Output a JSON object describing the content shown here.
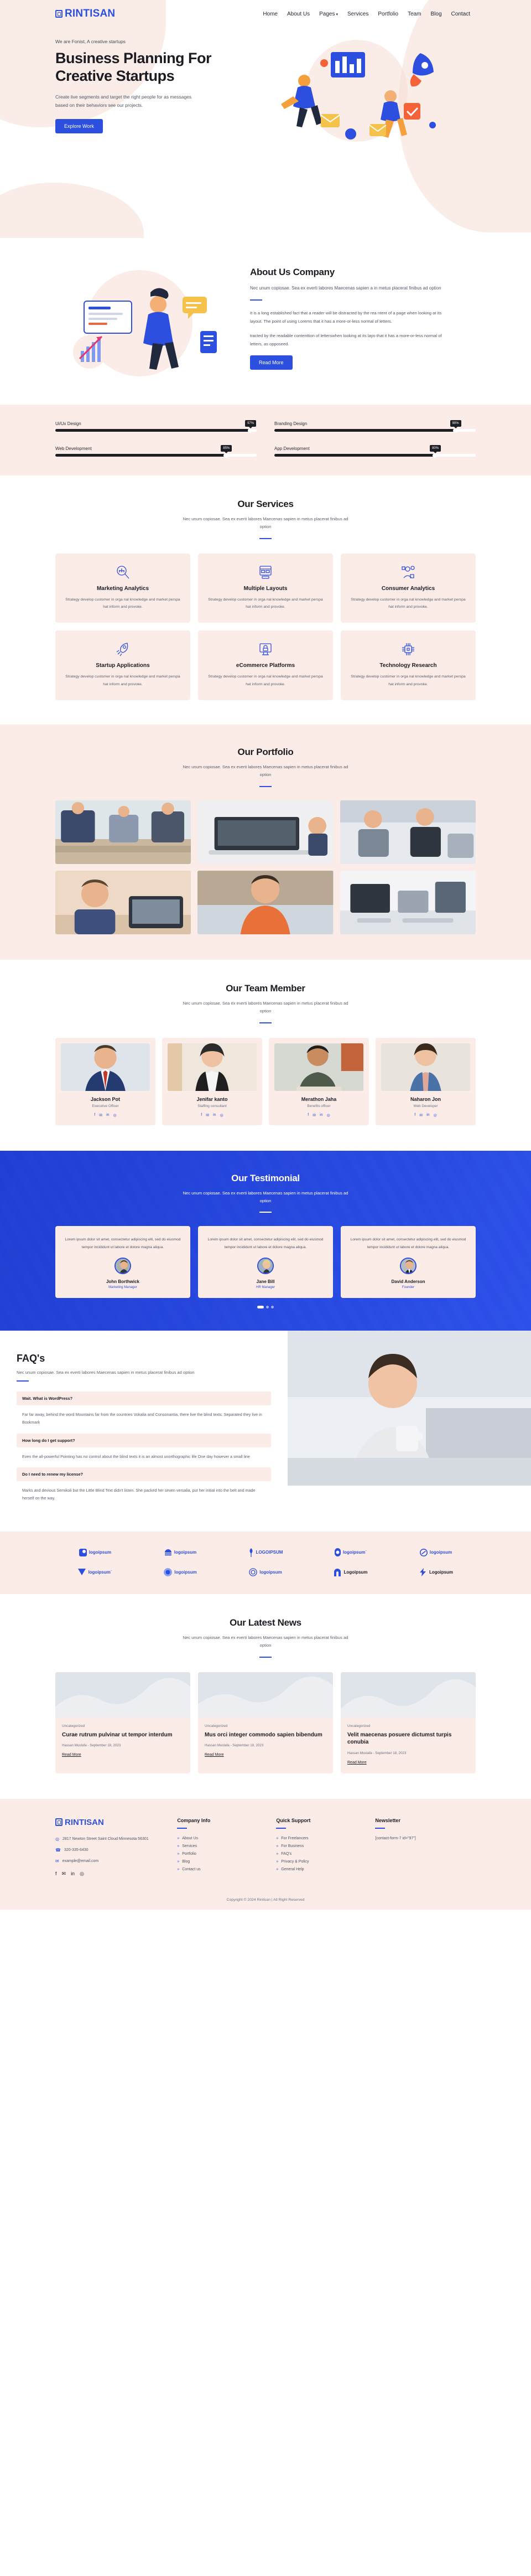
{
  "brand": {
    "name": "RINTISAN",
    "accent": "#2c4fe0",
    "cream": "#fbece7"
  },
  "nav": {
    "items": [
      {
        "label": "Home"
      },
      {
        "label": "About Us"
      },
      {
        "label": "Pages",
        "caret": "▾"
      },
      {
        "label": "Services"
      },
      {
        "label": "Portfolio"
      },
      {
        "label": "Team"
      },
      {
        "label": "Blog"
      },
      {
        "label": "Contact"
      }
    ]
  },
  "hero": {
    "eyebrow": "We are Fonist, A creative startups",
    "title_line1": "Business Planning For",
    "title_line2": "Creative Startups",
    "description": "Create live segments and target the right people for as messages based on their behaviors see our projects.",
    "cta": "Explore Work"
  },
  "about": {
    "title": "About Us Company",
    "lead": "Nec unum copiosae. Sea ex everti labores Maecenas sapien a in metus placerat finibus ad option",
    "paragraph1": "It is a long established fact that a reader will be distracted by the rea ntent of a page when looking at its layout. The point of using Lorems that it has a more-or-less normal of letters.",
    "paragraph2": "tracted by the readable contenttion of letterswhen looking at its layo that it has a more-or-less normal of letters, as opposeed.",
    "cta": "Read More"
  },
  "skills": {
    "items": [
      {
        "label": "Ui/Ux Design",
        "value": 97,
        "display": "97%"
      },
      {
        "label": "Branding Design",
        "value": 90,
        "display": "90%"
      },
      {
        "label": "Web Development",
        "value": 85,
        "display": "85%"
      },
      {
        "label": "App Development",
        "value": 80,
        "display": "80%"
      }
    ]
  },
  "services": {
    "title": "Our Services",
    "subtitle": "Nec unum copiosae. Sea ex everti labores Maecenas sapien in metus placerat finibus ad option",
    "items": [
      {
        "icon": "marketing-analytics-icon",
        "title": "Marketing Analytics",
        "desc": "Strategy develop customer in orga nal knowledge and market perspa hat inform and provoke."
      },
      {
        "icon": "multiple-layouts-icon",
        "title": "Multiple Layouts",
        "desc": "Strategy develop customer in orga nal knowledge and market perspa hat inform and provoke."
      },
      {
        "icon": "consumer-analytics-icon",
        "title": "Consumer Analytics",
        "desc": "Strategy develop customer in orga nal knowledge and market perspa hat inform and provoke."
      },
      {
        "icon": "startup-applications-icon",
        "title": "Startup Applications",
        "desc": "Strategy develop customer in orga nal knowledge and market perspa hat inform and provoke."
      },
      {
        "icon": "ecommerce-platforms-icon",
        "title": "eCommerce Platforms",
        "desc": "Strategy develop customer in orga nal knowledge and market perspa hat inform and provoke."
      },
      {
        "icon": "technology-research-icon",
        "title": "Technology Research",
        "desc": "Strategy develop customer in orga nal knowledge and market perspa hat inform and provoke."
      }
    ]
  },
  "portfolio": {
    "title": "Our Portfolio",
    "subtitle": "Nec unum copiosae. Sea ex everti labores Maecenas sapien in metus placerat finibus ad option",
    "items": [
      {
        "alt": "team-meeting-photo"
      },
      {
        "alt": "laptop-desk-photo"
      },
      {
        "alt": "office-discussion-photo"
      },
      {
        "alt": "man-with-glasses-photo"
      },
      {
        "alt": "man-orange-shirt-photo"
      },
      {
        "alt": "workspace-photo"
      }
    ]
  },
  "team": {
    "title": "Our Team Member",
    "subtitle": "Nec unum copiosae. Sea ex everti labores Maecenas sapien in metus placerat finibus ad option",
    "members": [
      {
        "name": "Jackson Pot",
        "role": "Executive Officer",
        "photo": "man-in-suit-photo"
      },
      {
        "name": "Jenifar kanto",
        "role": "Staffing consultant",
        "photo": "woman-in-blazer-photo"
      },
      {
        "name": "Merathon Jaha",
        "role": "Benefits officer",
        "photo": "man-green-sweater-photo"
      },
      {
        "name": "Naharon Jon",
        "role": "Web Developer",
        "photo": "woman-denim-jacket-photo"
      }
    ],
    "social": [
      "f",
      "✉",
      "in",
      "◎"
    ]
  },
  "testimonial": {
    "title": "Our Testimonial",
    "subtitle": "Nec unum copiosae. Sea ex everti labores Maecenas sapien in metus placerat finibus ad option",
    "items": [
      {
        "text": "Lorem ipsum dolor sit amet, consectetur adipiscing elit, sed do eiusmod tempor incididunt ut labore et dolore magna aliqua.",
        "name": "John Borthwick",
        "role": "Marketing Manager"
      },
      {
        "text": "Lorem ipsum dolor sit amet, consectetur adipiscing elit, sed do eiusmod tempor incididunt ut labore et dolore magna aliqua.",
        "name": "Jane Bill",
        "role": "HR Manager"
      },
      {
        "text": "Lorem ipsum dolor sit amet, consectetur adipiscing elit, sed do eiusmod tempor incididunt ut labore et dolore magna aliqua.",
        "name": "David Anderson",
        "role": "Founder"
      }
    ]
  },
  "faq": {
    "title": "FAQ's",
    "subtitle": "Nec unum copiosae. Sea ex everti labores Maecenas sapien in metus placerat finibus ad option",
    "items": [
      {
        "q": "Wait. What is WordPress?",
        "a": "Far far away, behind the word Mountains far from the countries Vokalia and Consonantia, there live the blind texts. Separated they live in Bookmark"
      },
      {
        "q": "How long do I get support?",
        "a": "Even the all-powerful Pointing has no control about the blind texts it is an almost unorthographic life One day however a small line"
      },
      {
        "q": "Do I need to renew my license?",
        "a": "Marks and devious Semikoli but the Little Blind Text didn't listen. She packed her seven versalia, put her initial into the belt and made herself on the way."
      }
    ]
  },
  "logos": {
    "items": [
      {
        "label": "logoipsum",
        "mark": "square-bubble-mark",
        "style": "blue"
      },
      {
        "label": "logoipsum",
        "mark": "wave-dome-mark",
        "style": "blue"
      },
      {
        "label": "LOGOIPSUM",
        "mark": "feather-mark",
        "style": "blue"
      },
      {
        "label": "logoipsum˙",
        "mark": "pill-mark",
        "style": "blue"
      },
      {
        "label": "logoipsum",
        "mark": "circle-slash-mark",
        "style": "blue"
      },
      {
        "label": "logoipsum˙",
        "mark": "triangle-mark",
        "style": "blue"
      },
      {
        "label": "logoipsum",
        "mark": "dot-circle-mark",
        "style": "blue"
      },
      {
        "label": "logoipsum",
        "mark": "spiral-mark",
        "style": "blue"
      },
      {
        "label": "Logoipsum",
        "mark": "arch-mark",
        "style": "dark"
      },
      {
        "label": "Logoipsum",
        "mark": "lightning-mark",
        "style": "dark"
      }
    ]
  },
  "news": {
    "title": "Our Latest News",
    "subtitle": "Nec unum copiosae. Sea ex everti labores Maecenas sapien in metus placerat finibus ad option",
    "posts": [
      {
        "category": "Uncategorized",
        "title": "Curae rutrum pulvinar ut tempor interdum",
        "author": "Hassan Mustafa",
        "date": "September 18, 2023",
        "more": "Read More"
      },
      {
        "category": "Uncategorized",
        "title": "Mus orci integer commodo sapien bibendum",
        "author": "Hassan Mustafa",
        "date": "September 18, 2023",
        "more": "Read More"
      },
      {
        "category": "Uncategorized",
        "title": "Velit maecenas posuere dictumst turpis conubia",
        "author": "Hassan Mustafa",
        "date": "September 18, 2023",
        "more": "Read More"
      }
    ]
  },
  "footer": {
    "brand": "RINTISAN",
    "address": "2817 Newton Street Saint Cloud Minnesota 56301",
    "phone": "320-335-6430",
    "email": "example@email.com",
    "social": [
      "f",
      "✉",
      "in",
      "◎"
    ],
    "company_info": {
      "heading": "Company Info",
      "links": [
        "About Us",
        "Services",
        "Portfolio",
        "Blog",
        "Contact us"
      ]
    },
    "quick_support": {
      "heading": "Quick Support",
      "links": [
        "For Freelancers",
        "For Business",
        "FAQ's",
        "Privacy & Policy",
        "General Help"
      ]
    },
    "newsletter": {
      "heading": "Newsletter",
      "shortcode": "[contact-form-7 id=\"97\"]"
    },
    "copyright": "Copyright © 2024 Rintisan | All Right Reserved"
  }
}
